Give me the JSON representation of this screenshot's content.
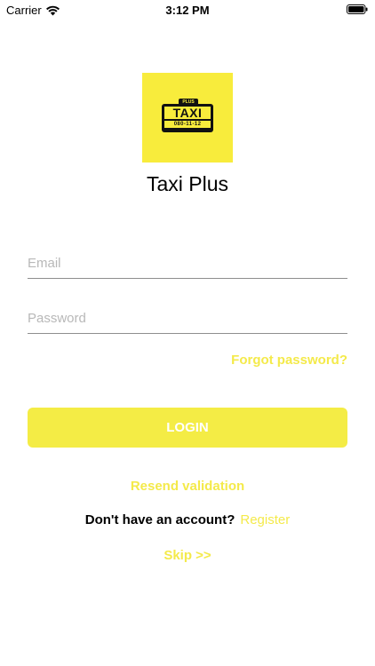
{
  "status_bar": {
    "carrier": "Carrier",
    "time": "3:12 PM",
    "wifi_icon": "wifi-icon",
    "battery_icon": "battery-icon"
  },
  "logo": {
    "plus": "PLUS",
    "word": "TAXI",
    "number": "080-11-12",
    "background_color": "#f8ec3c"
  },
  "app_title": "Taxi Plus",
  "form": {
    "email_placeholder": "Email",
    "email_value": "",
    "password_placeholder": "Password",
    "password_value": "",
    "forgot_password": "Forgot password?",
    "login_label": "LOGIN"
  },
  "links": {
    "resend_validation": "Resend validation",
    "register_prompt": "Don't have an account?",
    "register": "Register",
    "skip": "Skip >>"
  },
  "colors": {
    "accent": "#f4ec45",
    "text": "#000000"
  }
}
